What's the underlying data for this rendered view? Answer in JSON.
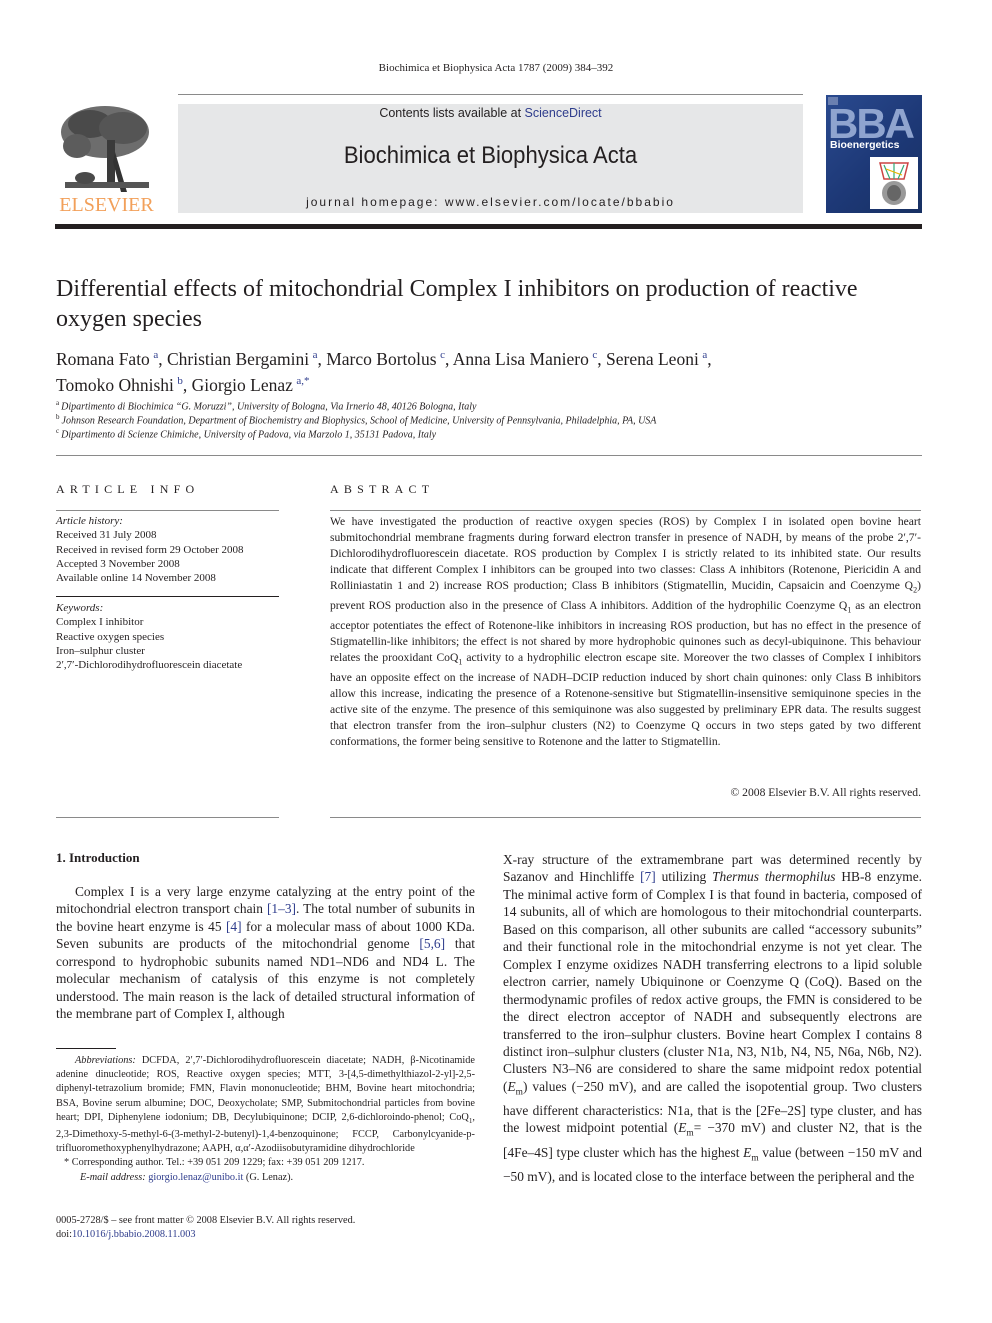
{
  "running_head": "Biochimica et Biophysica Acta 1787 (2009) 384–392",
  "masthead": {
    "publisher_logo_text": "ELSEVIER",
    "contents_prefix": "Contents lists available at ",
    "contents_link": "ScienceDirect",
    "journal_title": "Biochimica et Biophysica Acta",
    "homepage": "journal homepage: www.elsevier.com/locate/bbabio",
    "cover_title": "BBA",
    "cover_subtitle": "Bioenergetics"
  },
  "article": {
    "title": "Differential effects of mitochondrial Complex I inhibitors on production of reactive oxygen species",
    "authors": [
      {
        "name": "Romana Fato",
        "aff": "a"
      },
      {
        "name": "Christian Bergamini",
        "aff": "a"
      },
      {
        "name": "Marco Bortolus",
        "aff": "c"
      },
      {
        "name": "Anna Lisa Maniero",
        "aff": "c"
      },
      {
        "name": "Serena Leoni",
        "aff": "a"
      },
      {
        "name": "Tomoko Ohnishi",
        "aff": "b"
      },
      {
        "name": "Giorgio Lenaz",
        "aff": "a,*"
      }
    ],
    "affiliations": [
      {
        "key": "a",
        "text": "Dipartimento di Biochimica “G. Moruzzi”, University of Bologna, Via Irnerio 48, 40126 Bologna, Italy"
      },
      {
        "key": "b",
        "text": "Johnson Research Foundation, Department of Biochemistry and Biophysics, School of Medicine, University of Pennsylvania, Philadelphia, PA, USA"
      },
      {
        "key": "c",
        "text": "Dipartimento di Scienze Chimiche, University of Padova, via Marzolo 1, 35131 Padova, Italy"
      }
    ]
  },
  "article_info": {
    "heading": "ARTICLE INFO",
    "history_label": "Article history:",
    "history": [
      "Received 31 July 2008",
      "Received in revised form 29 October 2008",
      "Accepted 3 November 2008",
      "Available online 14 November 2008"
    ],
    "keywords_label": "Keywords:",
    "keywords": [
      "Complex I inhibitor",
      "Reactive oxygen species",
      "Iron–sulphur cluster",
      "2′,7′-Dichlorodihydrofluorescein diacetate"
    ]
  },
  "abstract": {
    "heading": "ABSTRACT",
    "parts": [
      "We have investigated the production of reactive oxygen species (ROS) by Complex I in isolated open bovine heart submitochondrial membrane fragments during forward electron transfer in presence of NADH, by means of the probe 2′,7′-Dichlorodihydrofluorescein diacetate. ROS production by Complex I is strictly related to its inhibited state. Our results indicate that different Complex I inhibitors can be grouped into two classes: Class A inhibitors (Rotenone, Piericidin A and Rolliniastatin 1 and 2) increase ROS production; Class B inhibitors (Stigmatellin, Mucidin, Capsaicin and Coenzyme Q",
      "2",
      ") prevent ROS production also in the presence of Class A inhibitors. Addition of the hydrophilic Coenzyme Q",
      "1",
      " as an electron acceptor potentiates the effect of Rotenone-like inhibitors in increasing ROS production, but has no effect in the presence of Stigmatellin-like inhibitors; the effect is not shared by more hydrophobic quinones such as decyl-ubiquinone. This behaviour relates the prooxidant CoQ",
      "1",
      " activity to a hydrophilic electron escape site. Moreover the two classes of Complex I inhibitors have an opposite effect on the increase of NADH–DCIP reduction induced by short chain quinones: only Class B inhibitors allow this increase, indicating the presence of a Rotenone-sensitive but Stigmatellin-insensitive semiquinone species in the active site of the enzyme. The presence of this semiquinone was also suggested by preliminary EPR data. The results suggest that electron transfer from the iron–sulphur clusters (N2) to Coenzyme Q occurs in two steps gated by two different conformations, the former being sensitive to Rotenone and the latter to Stigmatellin."
    ],
    "copyright": "© 2008 Elsevier B.V. All rights reserved."
  },
  "intro": {
    "heading": "1. Introduction",
    "left": [
      "Complex I is a very large enzyme catalyzing at the entry point of the mitochondrial electron transport chain ",
      "[1–3]",
      ". The total number of subunits in the bovine heart enzyme is 45 ",
      "[4]",
      " for a molecular mass of about 1000 KDa. Seven subunits are products of the mitochondrial genome ",
      "[5,6]",
      " that correspond to hydrophobic subunits named ND1–ND6 and ND4 L. The molecular mechanism of catalysis of this enzyme is not completely understood. The main reason is the lack of detailed structural information of the membrane part of Complex I, although"
    ],
    "right": [
      "X-ray structure of the extramembrane part was determined recently by Sazanov and Hinchliffe ",
      "[7]",
      " utilizing ",
      "Thermus thermophilus",
      " HB-8 enzyme. The minimal active form of Complex I is that found in bacteria, composed of 14 subunits, all of which are homologous to their mitochondrial counterparts. Based on this comparison, all other subunits are called “accessory subunits” and their functional role in the mitochondrial enzyme is not yet clear. The Complex I enzyme oxidizes NADH transferring electrons to a lipid soluble electron carrier, namely Ubiquinone or Coenzyme Q (CoQ). Based on the thermodynamic profiles of redox active groups, the FMN is considered to be the direct electron acceptor of NADH and subsequently electrons are transferred to the iron–sulphur clusters. Bovine heart Complex I contains 8 distinct iron–sulphur clusters (cluster N1a, N3, N1b, N4, N5, N6a, N6b, N2). Clusters N3–N6 are considered to share the same midpoint redox potential (",
      "E",
      "m",
      ") values (−250 mV), and are called the isopotential group. Two clusters have different characteristics: N1a, that is the [2Fe–2S] type cluster, and has the lowest midpoint potential (",
      "E",
      "m",
      "= −370 mV) and cluster N2, that is the [4Fe–4S] type cluster which has the highest ",
      "E",
      "m",
      " value (between −150 mV and −50 mV), and is located close to the interface between the peripheral and the"
    ]
  },
  "footnotes": {
    "abbr_label": "Abbreviations:",
    "abbr_text": " DCFDA, 2′,7′-Dichlorodihydrofluorescein diacetate; NADH, β-Nicotinamide adenine dinucleotide; ROS, Reactive oxygen species; MTT, 3-[4,5-dimethylthiazol-2-yl]-2,5-diphenyl-tetrazolium bromide; FMN, Flavin mononucleotide; BHM, Bovine heart mitochondria; BSA, Bovine serum albumine; DOC, Deoxycholate; SMP, Submitochondrial particles from bovine heart; DPI, Diphenylene iodonium; DB, Decylubiquinone; DCIP, 2,6-dichloroindo-phenol; CoQ",
    "abbr_sub": "1",
    "abbr_text2": ", 2,3-Dimethoxy-5-methyl-6-(3-methyl-2-butenyl)-1,4-benzoquinone; FCCP, Carbonylcyanide-p-trifluoromethoxyphenylhydrazone; AAPH, α,α′-Azodiisobutyramidine dihydrochloride",
    "corresponding": "* Corresponding author. Tel.: +39 051 209 1229; fax: +39 051 209 1217.",
    "email_label": "E-mail address:",
    "email": "giorgio.lenaz@unibo.it",
    "email_suffix": " (G. Lenaz).",
    "front_matter": "0005-2728/$ – see front matter © 2008 Elsevier B.V. All rights reserved.",
    "doi_prefix": "doi:",
    "doi": "10.1016/j.bbabio.2008.11.003"
  },
  "colors": {
    "link": "#2e3c8c",
    "elsevier_orange": "#f2a05a",
    "masthead_bg": "#e6e7e8",
    "cover_blue": "#1d3876"
  }
}
